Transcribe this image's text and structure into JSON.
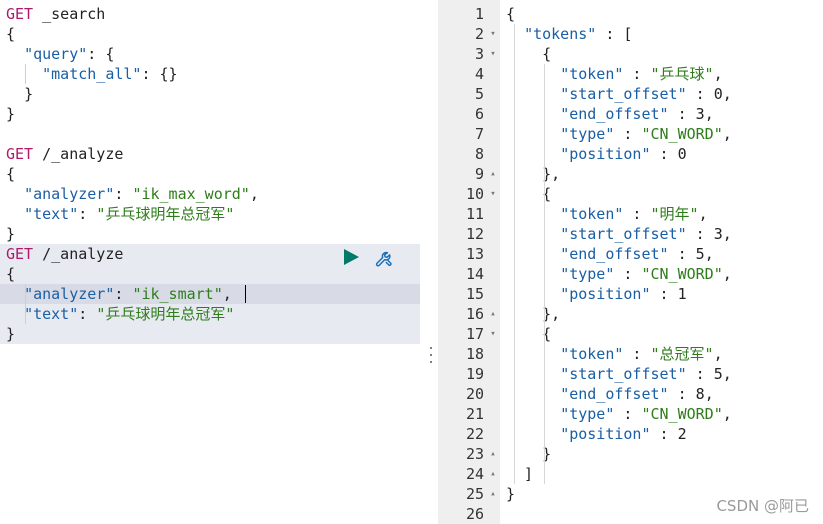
{
  "left_editor": {
    "request1": {
      "method": "GET",
      "path": "_search",
      "lines": [
        "{",
        "\"query\"",
        ": {",
        "\"match_all\"",
        ": {}",
        "}",
        "}"
      ]
    },
    "request2": {
      "method": "GET",
      "path": "/_analyze",
      "analyzer_key": "\"analyzer\"",
      "analyzer_value": "\"ik_max_word\"",
      "text_key": "\"text\"",
      "text_value": "\"乒乓球明年总冠军\""
    },
    "request3": {
      "method": "GET",
      "path": "/_analyze",
      "analyzer_key": "\"analyzer\"",
      "analyzer_value": "\"ik_smart\"",
      "text_key": "\"text\"",
      "text_value": "\"乒乓球明年总冠军\""
    },
    "actions": {
      "run": "play-icon",
      "settings": "wrench-icon"
    }
  },
  "output": {
    "line_numbers": [
      "1",
      "2",
      "3",
      "4",
      "5",
      "6",
      "7",
      "8",
      "9",
      "10",
      "11",
      "12",
      "13",
      "14",
      "15",
      "16",
      "17",
      "18",
      "19",
      "20",
      "21",
      "22",
      "23",
      "24",
      "25",
      "26"
    ],
    "tokens_key": "\"tokens\"",
    "tokens": [
      {
        "token": "\"乒乓球\"",
        "start_offset": "0",
        "end_offset": "3",
        "type": "\"CN_WORD\"",
        "position": "0"
      },
      {
        "token": "\"明年\"",
        "start_offset": "3",
        "end_offset": "5",
        "type": "\"CN_WORD\"",
        "position": "1"
      },
      {
        "token": "\"总冠军\"",
        "start_offset": "5",
        "end_offset": "8",
        "type": "\"CN_WORD\"",
        "position": "2"
      }
    ],
    "keys": {
      "token": "\"token\"",
      "start_offset": "\"start_offset\"",
      "end_offset": "\"end_offset\"",
      "type": "\"type\"",
      "position": "\"position\""
    }
  },
  "watermark": "CSDN @阿已",
  "colors": {
    "key": "#1a5fa5",
    "string": "#2e7d1a",
    "method": "#b0186b",
    "active_request_bg": "#e8eaf2",
    "gutter_bg": "#efefef",
    "run_button": "#00796b"
  }
}
